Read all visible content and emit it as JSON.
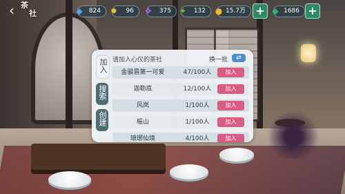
{
  "header": {
    "back": "‹",
    "title_line1": "茶",
    "title_line2": "社"
  },
  "resources": [
    {
      "icon": "blue-gem-icon",
      "value": "824",
      "color": "#5aa0e6"
    },
    {
      "icon": "gold-coin-icon",
      "value": "96",
      "color": "#f2c13a"
    },
    {
      "icon": "purple-gem-icon",
      "value": "375",
      "color": "#a661d6"
    },
    {
      "icon": "green-gem-icon",
      "value": "132",
      "color": "#68c24a"
    },
    {
      "icon": "gold-coin-icon",
      "value": "15.7万",
      "color": "#f0b62c"
    },
    {
      "icon": "emerald-icon",
      "value": "1686",
      "color": "#2fb37a"
    }
  ],
  "plus": "+",
  "dialog": {
    "title": "请加入心仪的茶社",
    "refresh_label": "换一批",
    "refresh_icon": "⇄",
    "tabs": [
      "加入",
      "搜索",
      "创建"
    ],
    "join_label": "加入",
    "rows": [
      {
        "name": "金骏眉第一可爱",
        "count": "47/100人"
      },
      {
        "name": "迦勒底",
        "count": "12/100人"
      },
      {
        "name": "风岚",
        "count": "1/100人"
      },
      {
        "name": "榣山",
        "count": "1/100人"
      },
      {
        "name": "琅琊仙境",
        "count": "4/100人"
      }
    ]
  }
}
